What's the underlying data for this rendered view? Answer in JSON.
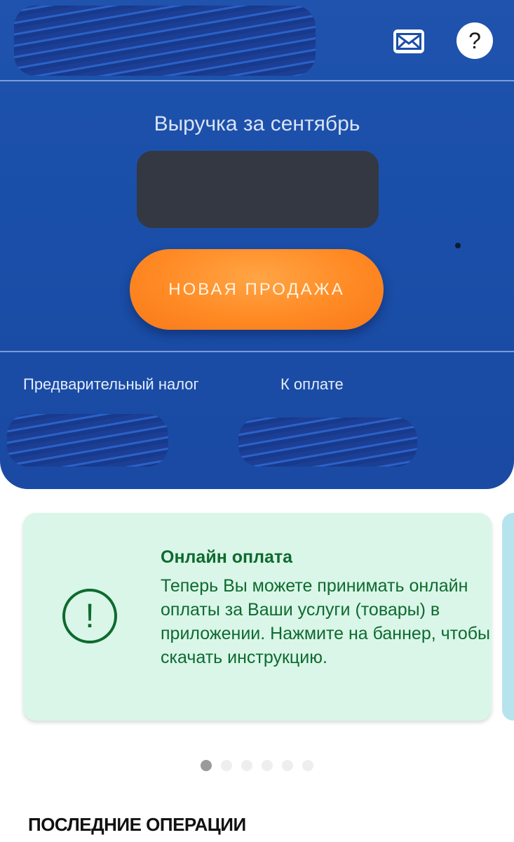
{
  "header": {
    "mail_icon": "mail-icon",
    "help_icon": "help-icon",
    "help_symbol": "?"
  },
  "revenue": {
    "title": "Выручка за сентябрь"
  },
  "actions": {
    "new_sale_label": "НОВАЯ ПРОДАЖА",
    "new_sale_color": "#ff8a24"
  },
  "summary": {
    "tax_label": "Предварительный налог",
    "pay_label": "К оплате"
  },
  "banner": {
    "title": "Онлайн оплата",
    "text": "Теперь Вы можете принимать онлайн оплаты за Ваши услуги (товары) в приложении. Нажмите на баннер, чтобы скачать инструкцию.",
    "icon": "warning-icon",
    "icon_symbol": "!",
    "background": "#d9f6e9",
    "text_color": "#0f6a2e"
  },
  "pager": {
    "total": 6,
    "active": 1
  },
  "operations": {
    "title": "ПОСЛЕДНИЕ ОПЕРАЦИИ"
  },
  "colors": {
    "panel_blue": "#1a4fa9",
    "accent_orange": "#ff8a24"
  }
}
